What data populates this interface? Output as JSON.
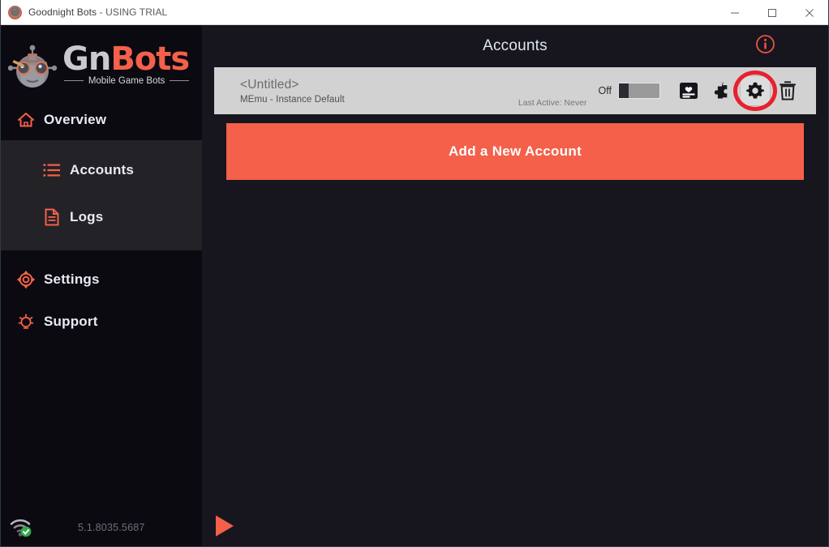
{
  "window": {
    "app_title": "Goodnight Bots",
    "title_suffix": " - USING TRIAL",
    "icon": "robot-head-icon",
    "controls": {
      "minimize": "minimize-icon",
      "maximize": "maximize-icon",
      "close": "close-icon"
    }
  },
  "sidebar": {
    "logo": {
      "brand_part1": "Gn",
      "brand_part2": "Bots",
      "tagline": "Mobile Game Bots",
      "icon": "robot-head-logo"
    },
    "items": [
      {
        "label": "Overview",
        "icon": "home-icon",
        "selected": false
      },
      {
        "label": "Accounts",
        "icon": "list-icon",
        "selected": true
      },
      {
        "label": "Logs",
        "icon": "document-icon",
        "selected": false
      },
      {
        "label": "Settings",
        "icon": "gear-icon",
        "selected": false
      },
      {
        "label": "Support",
        "icon": "lightbulb-icon",
        "selected": false
      }
    ],
    "status": {
      "connection_icon": "wifi-connected-icon",
      "version": "5.1.8035.5687"
    }
  },
  "main": {
    "header": {
      "title": "Accounts",
      "info_icon": "info-circle-icon"
    },
    "accounts": [
      {
        "name": "<Untitled>",
        "emulator": "MEmu - Instance Default",
        "last_active": "Last Active: Never",
        "toggle_label": "Off",
        "toggle_state": "off",
        "actions": [
          {
            "icon": "profile-card-icon",
            "name": "account-details-button"
          },
          {
            "icon": "puzzle-piece-icon",
            "name": "plugins-button"
          },
          {
            "icon": "gear-icon",
            "name": "account-settings-button",
            "annotated": true
          },
          {
            "icon": "trash-icon",
            "name": "delete-account-button"
          }
        ]
      }
    ],
    "add_account_label": "Add a New Account",
    "footer": {
      "play_icon": "play-icon"
    }
  },
  "colors": {
    "accent": "#f4604a",
    "annotation": "#e8202f",
    "sidebar_bg": "#0b0a10",
    "submenu_bg": "#232227",
    "main_bg": "#17161f",
    "row_bg": "#d2d2d2",
    "title_text": "#dfe6f0",
    "status_ok": "#2faa4a"
  }
}
